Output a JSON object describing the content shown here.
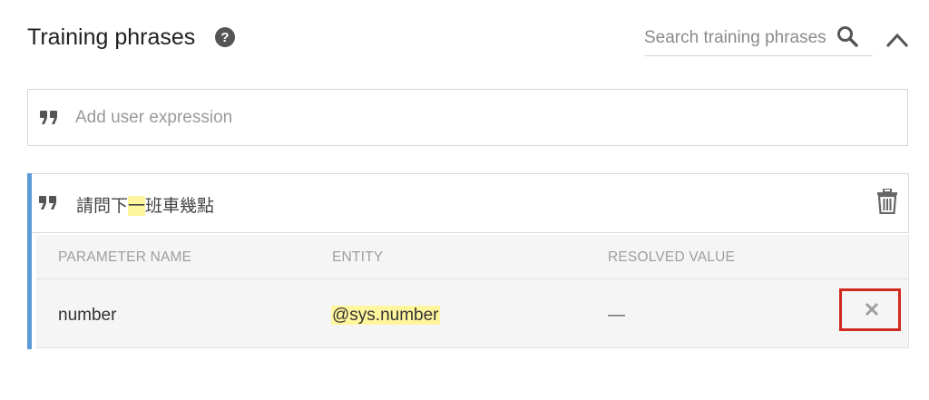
{
  "header": {
    "title": "Training phrases",
    "search_placeholder": "Search training phrases"
  },
  "add_expression": {
    "placeholder": "Add user expression"
  },
  "phrase": {
    "text_before": "請問下",
    "text_highlight": "一",
    "text_after": "班車幾點"
  },
  "parameters": {
    "columns": [
      "PARAMETER NAME",
      "ENTITY",
      "RESOLVED VALUE"
    ],
    "rows": [
      {
        "name": "number",
        "entity": "@sys.number",
        "resolved_value": "—"
      }
    ]
  },
  "colors": {
    "accent_border": "#5b9bd5",
    "highlight": "#fff59d",
    "remove_outline": "#d12a1f"
  },
  "icons": [
    "help-icon",
    "search-icon",
    "chevron-up-icon",
    "quote-icon",
    "trash-icon",
    "close-icon"
  ]
}
